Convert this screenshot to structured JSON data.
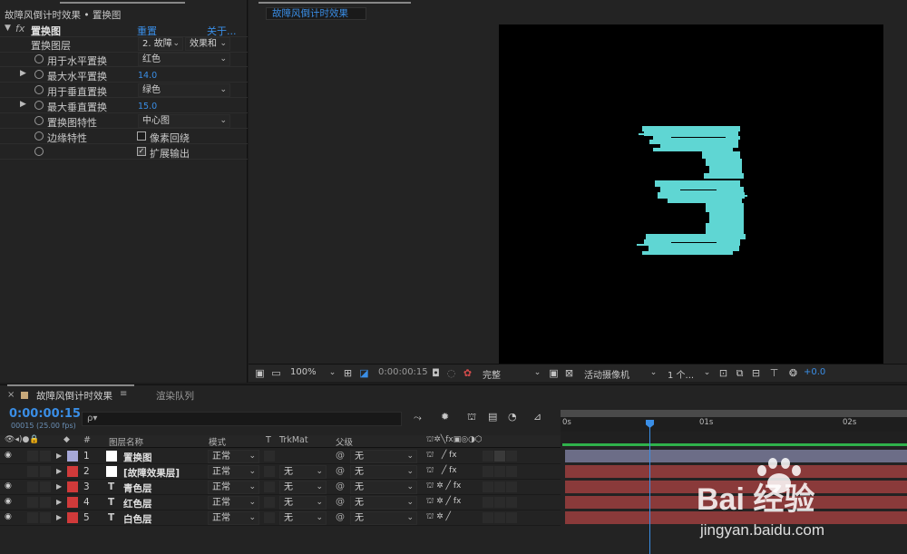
{
  "effect_controls": {
    "title": "故障风倒计时效果 • 置换图",
    "effect_name": "置换图",
    "reset": "重置",
    "about": "关于...",
    "props": [
      {
        "label": "置换图层",
        "dd1": "2. 故障",
        "dd2": "效果和"
      },
      {
        "label": "用于水平置换",
        "value": "红色"
      },
      {
        "label": "最大水平置换",
        "value": "14.0"
      },
      {
        "label": "用于垂直置换",
        "value": "绿色"
      },
      {
        "label": "最大垂直置换",
        "value": "15.0"
      },
      {
        "label": "置换图特性",
        "value": "中心图"
      },
      {
        "label": "边缘特性",
        "value": "像素回绕"
      },
      {
        "label": "",
        "value": "扩展输出"
      }
    ]
  },
  "viewer": {
    "tab": "故障风倒计时效果",
    "zoom": "100%",
    "timecode": "0:00:00:15",
    "resolution": "完整",
    "camera": "活动摄像机",
    "views": "1 个...",
    "exposure": "+0.0"
  },
  "timeline": {
    "comp_tab": "故障风倒计时效果",
    "render_tab": "渲染队列",
    "timecode": "0:00:00:15",
    "frame_info": "00015 (25.00 fps)",
    "search_placeholder": "ρ▾",
    "headers": {
      "num": "#",
      "name": "图层名称",
      "mode": "模式",
      "t": "T",
      "trkmat": "TrkMat",
      "parent": "父级"
    },
    "ruler": [
      "0s",
      "01s",
      "02s"
    ],
    "layers": [
      {
        "num": "1",
        "name": "置换图",
        "mode": "正常",
        "trkmat": "",
        "parent": "无",
        "color": "#a6a8d8"
      },
      {
        "num": "2",
        "name": "[故障效果层]",
        "mode": "正常",
        "trkmat": "无",
        "parent": "无",
        "color": "#d03a3a"
      },
      {
        "num": "3",
        "name": "青色层",
        "mode": "正常",
        "trkmat": "无",
        "parent": "无",
        "color": "#d03a3a"
      },
      {
        "num": "4",
        "name": "红色层",
        "mode": "正常",
        "trkmat": "无",
        "parent": "无",
        "color": "#d03a3a"
      },
      {
        "num": "5",
        "name": "白色层",
        "mode": "正常",
        "trkmat": "无",
        "parent": "无",
        "color": "#d03a3a"
      }
    ]
  },
  "watermark": {
    "brand": "Bai 经验",
    "url": "jingyan.baidu.com"
  }
}
